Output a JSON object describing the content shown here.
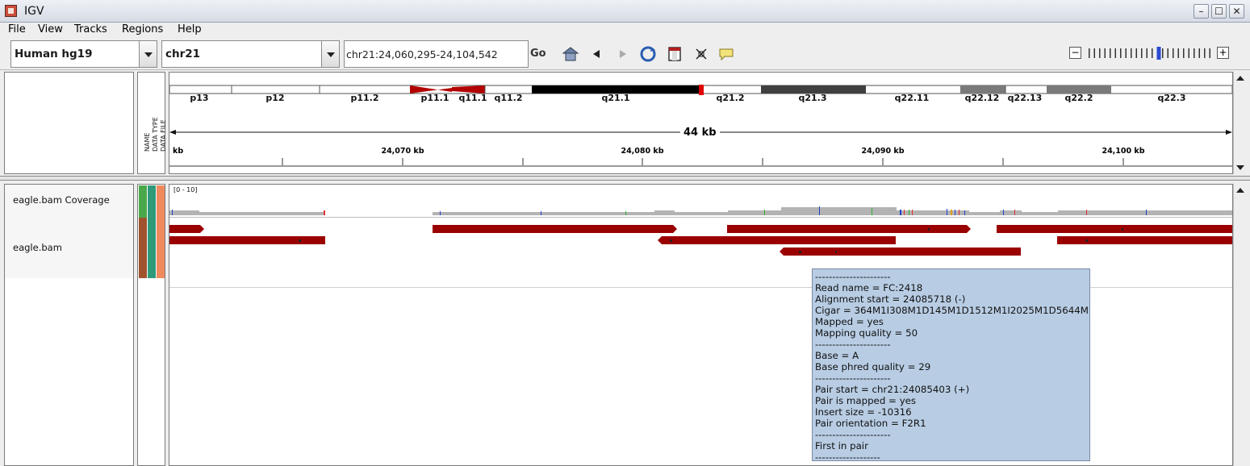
{
  "window": {
    "app_title": "IGV",
    "minimize_symbol": "–",
    "maximize_symbol": "☐",
    "close_symbol": "✕"
  },
  "menu": {
    "file": "File",
    "view": "View",
    "tracks": "Tracks",
    "regions": "Regions",
    "help": "Help"
  },
  "toolbar": {
    "genome": "Human hg19",
    "chromosome": "chr21",
    "locus": "chr21:24,060,295-24,104,542",
    "go_label": "Go",
    "zoom_minus": "−",
    "zoom_plus": "+",
    "zoom_level": 0.55
  },
  "ideogram": {
    "bands": [
      "p13",
      "p12",
      "p11.2",
      "p11.1",
      "q11.1",
      "q11.2",
      "q21.1",
      "q21.2",
      "q21.3",
      "q22.11",
      "q22.12",
      "q22.13",
      "q22.2",
      "q22.3"
    ]
  },
  "ruler": {
    "span_label": "44 kb",
    "unit_label": "kb",
    "ticks": [
      "24,070 kb",
      "24,080 kb",
      "24,090 kb",
      "24,100 kb"
    ]
  },
  "attribute_headers": [
    "NAME",
    "DATA TYPE",
    "DATA FILE"
  ],
  "tracks": {
    "coverage_name": "eagle.bam Coverage",
    "coverage_range": "[0 - 10]",
    "alignment_name": "eagle.bam"
  },
  "popup": {
    "lines": [
      "----------------------",
      "Read name = FC:2418",
      "Alignment start = 24085718 (-)",
      "Cigar = 364M1I308M1D145M1D1512M1I2025M1D5644M",
      "Mapped = yes",
      "Mapping quality = 50",
      "----------------------",
      "Base = A",
      "Base phred quality = 29",
      "----------------------",
      "Pair start = chr21:24085403 (+)",
      "Pair is mapped = yes",
      "Insert size = -10316",
      "Pair orientation = F2R1",
      "----------------------",
      "First in pair",
      "-------------------"
    ]
  },
  "colors": {
    "read": "#9b0000",
    "centromere": "#b30000",
    "popup_bg": "#b8cde4",
    "attr_name": "#4aa84a",
    "attr_type": "#2f9a7a",
    "attr_file": "#f08a5d"
  }
}
